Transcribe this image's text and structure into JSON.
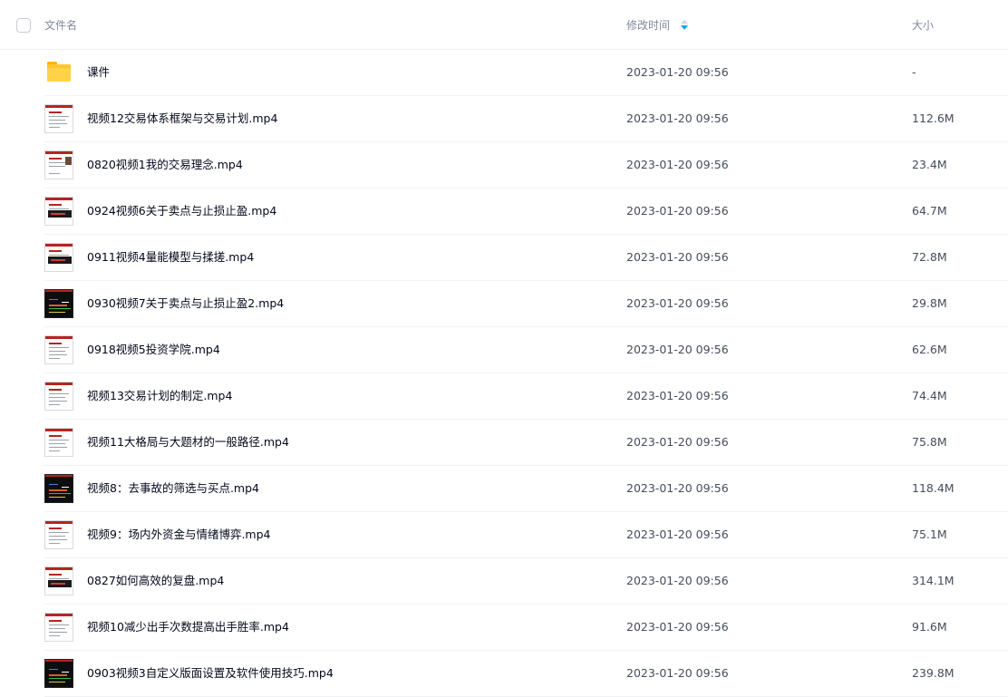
{
  "header": {
    "name_label": "文件名",
    "time_label": "修改时间",
    "size_label": "大小",
    "sort_direction": "descending"
  },
  "colors": {
    "accent": "#06a7ff",
    "folder": "#ffc62e",
    "divider": "#f1f2f4"
  },
  "files": [
    {
      "name": "课件",
      "time": "2023-01-20 09:56",
      "size": "-",
      "icon": "folder-icon"
    },
    {
      "name": "视频12交易体系框架与交易计划.mp4",
      "time": "2023-01-20 09:56",
      "size": "112.6M",
      "icon": "video-thumbnail"
    },
    {
      "name": "0820视频1我的交易理念.mp4",
      "time": "2023-01-20 09:56",
      "size": "23.4M",
      "icon": "video-thumbnail"
    },
    {
      "name": "0924视频6关于卖点与止损止盈.mp4",
      "time": "2023-01-20 09:56",
      "size": "64.7M",
      "icon": "video-thumbnail"
    },
    {
      "name": "0911视频4量能模型与揉搓.mp4",
      "time": "2023-01-20 09:56",
      "size": "72.8M",
      "icon": "video-thumbnail"
    },
    {
      "name": "0930视频7关于卖点与止损止盈2.mp4",
      "time": "2023-01-20 09:56",
      "size": "29.8M",
      "icon": "video-thumbnail"
    },
    {
      "name": "0918视频5投资学院.mp4",
      "time": "2023-01-20 09:56",
      "size": "62.6M",
      "icon": "video-thumbnail"
    },
    {
      "name": "视频13交易计划的制定.mp4",
      "time": "2023-01-20 09:56",
      "size": "74.4M",
      "icon": "video-thumbnail"
    },
    {
      "name": "视频11大格局与大题材的一般路径.mp4",
      "time": "2023-01-20 09:56",
      "size": "75.8M",
      "icon": "video-thumbnail"
    },
    {
      "name": "视频8：去事故的筛选与买点.mp4",
      "time": "2023-01-20 09:56",
      "size": "118.4M",
      "icon": "video-thumbnail"
    },
    {
      "name": "视频9：场内外资金与情绪博弈.mp4",
      "time": "2023-01-20 09:56",
      "size": "75.1M",
      "icon": "video-thumbnail"
    },
    {
      "name": "0827如何高效的复盘.mp4",
      "time": "2023-01-20 09:56",
      "size": "314.1M",
      "icon": "video-thumbnail"
    },
    {
      "name": "视频10减少出手次数提高出手胜率.mp4",
      "time": "2023-01-20 09:56",
      "size": "91.6M",
      "icon": "video-thumbnail"
    },
    {
      "name": "0903视频3自定义版面设置及软件使用技巧.mp4",
      "time": "2023-01-20 09:56",
      "size": "239.8M",
      "icon": "video-thumbnail"
    }
  ]
}
